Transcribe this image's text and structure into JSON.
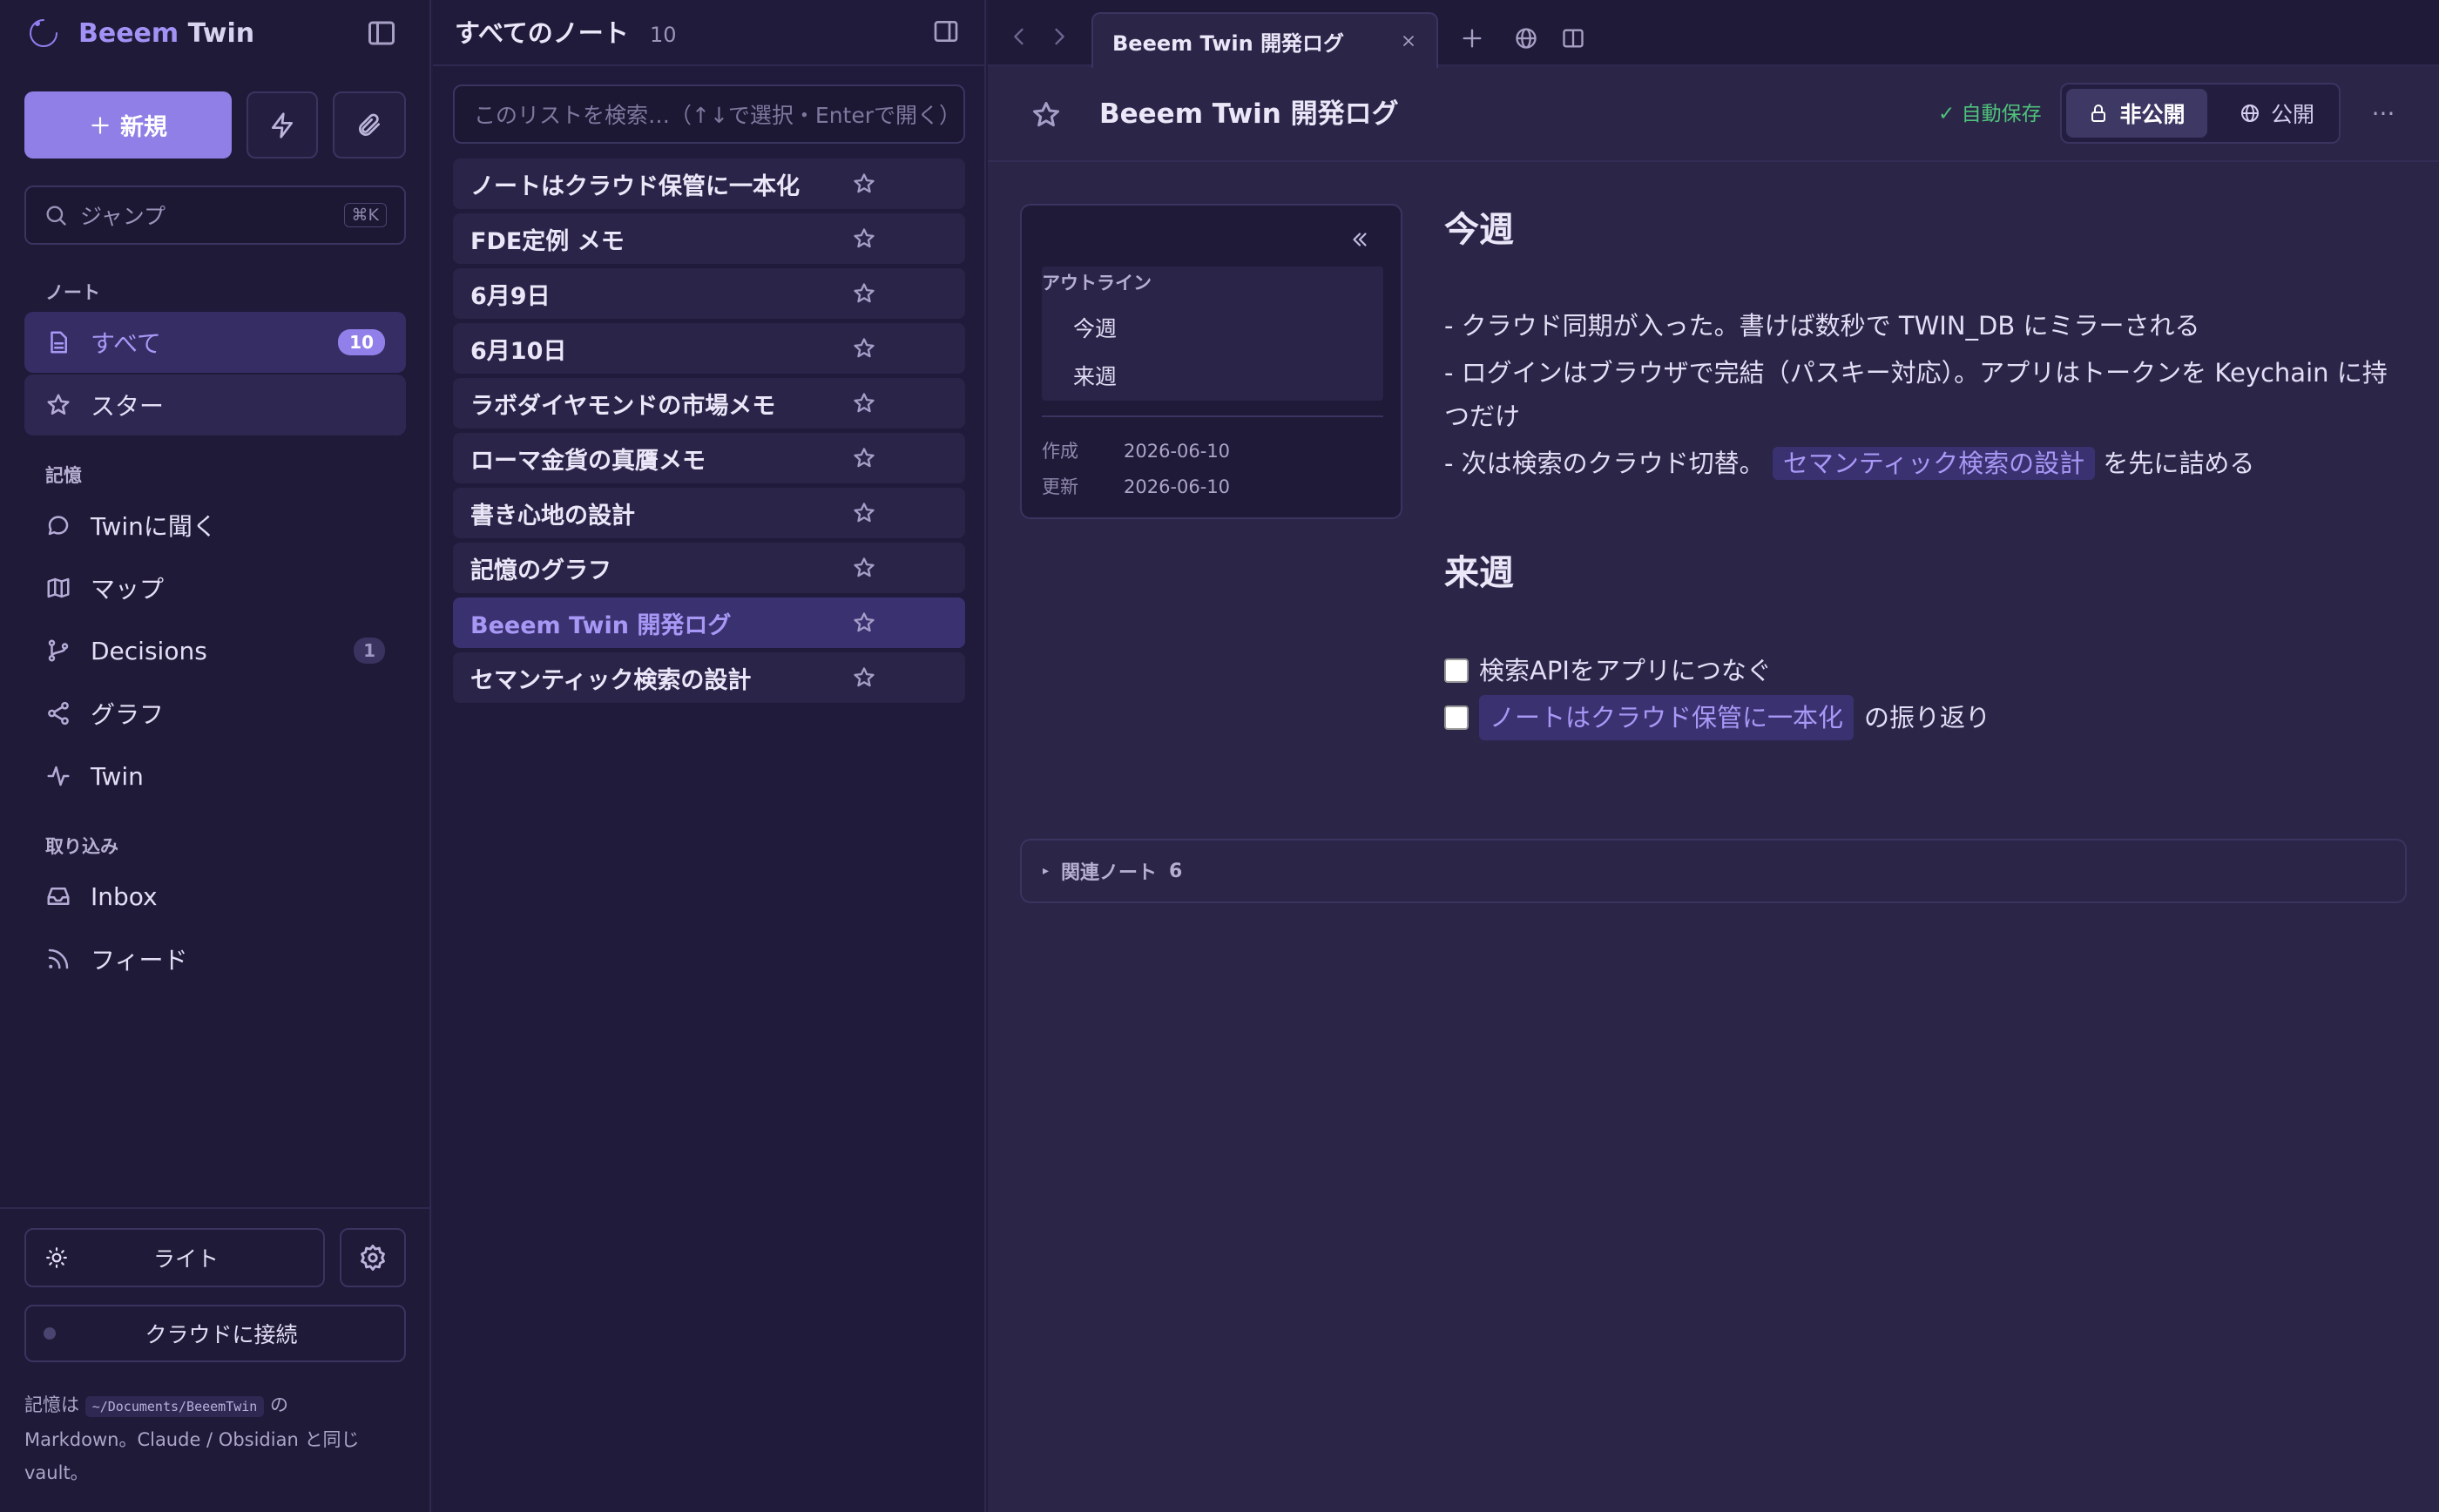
{
  "app": {
    "title_part1": "Beeem",
    "title_part2": "Twin"
  },
  "sidebar": {
    "new_label": "新規",
    "jump_placeholder": "ジャンプ",
    "jump_shortcut": "⌘K",
    "section_notes": "ノート",
    "all_label": "すべて",
    "all_count": "10",
    "star_label": "スター",
    "section_memory": "記憶",
    "ask_twin_label": "Twinに聞く",
    "map_label": "マップ",
    "decisions_label": "Decisions",
    "decisions_count": "1",
    "graph_label": "グラフ",
    "twin_label": "Twin",
    "section_import": "取り込み",
    "inbox_label": "Inbox",
    "feed_label": "フィード",
    "theme_label": "ライト",
    "cloud_label": "クラウドに接続",
    "vault_prefix": "記憶は",
    "vault_path": "~/Documents/BeeemTwin",
    "vault_suffix": "の",
    "vault_line2": "Markdown。Claude / Obsidian と同じ",
    "vault_line3": "vault。"
  },
  "list": {
    "title": "すべてのノート",
    "count": "10",
    "search_placeholder": "このリストを検索…（↑↓で選択・Enterで開く）",
    "notes": [
      "ノートはクラウド保管に一本化",
      "FDE定例 メモ",
      "6月9日",
      "6月10日",
      "ラボダイヤモンドの市場メモ",
      "ローマ金貨の真贋メモ",
      "書き心地の設計",
      "記憶のグラフ",
      "Beeem Twin 開発ログ",
      "セマンティック検索の設計"
    ]
  },
  "tabbar": {
    "active_tab": "Beeem Twin 開発ログ"
  },
  "editor": {
    "title": "Beeem Twin 開発ログ",
    "autosave": "✓ 自動保存",
    "private_label": "非公開",
    "public_label": "公開",
    "more_label": "···",
    "outline": {
      "label": "アウトライン",
      "items": [
        "今週",
        "来週"
      ],
      "created_label": "作成",
      "created": "2026-06-10",
      "updated_label": "更新",
      "updated": "2026-06-10"
    },
    "h_this_week": "今週",
    "line1": "- クラウド同期が入った。書けば数秒で TWIN_DB にミラーされる",
    "line2a": "- ログインはブラウザで完結（パスキー対応）。アプリはトークンを Keychain に持",
    "line2b": "つだけ",
    "line3_pre": "- 次は検索のクラウド切替。",
    "line3_link": "セマンティック検索の設計",
    "line3_post": "を先に詰める",
    "h_next_week": "来週",
    "todo1": "検索APIをアプリにつなぐ",
    "todo2_link": "ノートはクラウド保管に一本化",
    "todo2_post": "の振り返り",
    "related_label": "関連ノート",
    "related_count": "6"
  },
  "colors": {
    "accent": "#8f7fe6",
    "background": "#221d3e",
    "success": "#4ec37a"
  },
  "icons": [
    "logo-icon",
    "sidebar-toggle-icon",
    "plus-icon",
    "bolt-icon",
    "paperclip-icon",
    "search-icon",
    "document-icon",
    "star-icon",
    "chat-icon",
    "map-icon",
    "branch-icon",
    "share-icon",
    "pulse-icon",
    "inbox-icon",
    "rss-icon",
    "sun-icon",
    "gear-icon",
    "lock-icon",
    "globe-icon"
  ]
}
